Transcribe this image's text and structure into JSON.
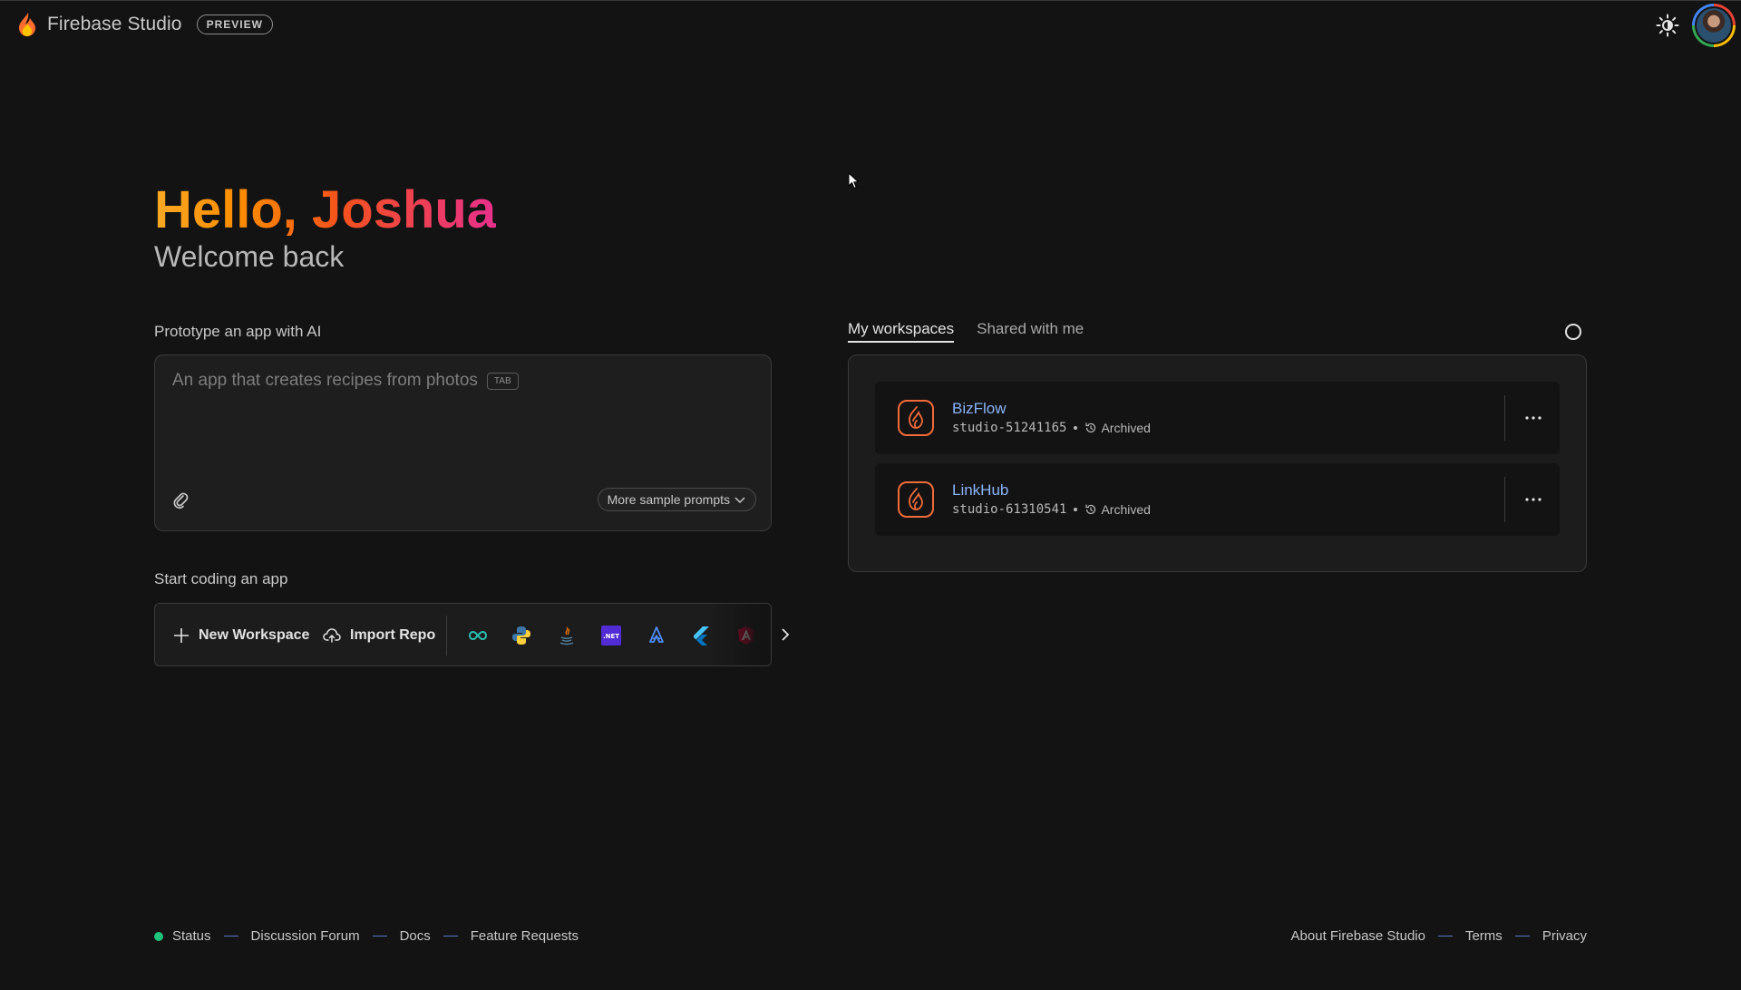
{
  "app": {
    "name": "Firebase Studio",
    "badge": "PREVIEW"
  },
  "greeting": {
    "hello": "Hello, Joshua",
    "subtitle": "Welcome back"
  },
  "prototype": {
    "label": "Prototype an app with AI",
    "placeholder": "An app that creates recipes from photos",
    "tab_hint": "TAB",
    "samples_button": "More sample prompts"
  },
  "coding": {
    "label": "Start coding an app",
    "new_workspace": "New Workspace",
    "import_repo": "Import Repo",
    "templates": [
      "go-icon",
      "python-icon",
      "java-icon",
      "dotnet-icon",
      "astro-icon",
      "flutter-icon",
      "angular-icon"
    ],
    "dotnet_label": ".NET"
  },
  "workspaces": {
    "tabs": [
      {
        "label": "My workspaces",
        "active": true
      },
      {
        "label": "Shared with me",
        "active": false
      }
    ],
    "items": [
      {
        "name": "BizFlow",
        "id": "studio-51241165",
        "status": "Archived"
      },
      {
        "name": "LinkHub",
        "id": "studio-61310541",
        "status": "Archived"
      }
    ]
  },
  "footer": {
    "left": [
      "Status",
      "Discussion Forum",
      "Docs",
      "Feature Requests"
    ],
    "right": [
      "About Firebase Studio",
      "Terms",
      "Privacy"
    ]
  },
  "colors": {
    "background": "#131313",
    "accent_link": "#8ab4f8",
    "status_ok": "#1ec27b",
    "brand_orange": "#f26b3a"
  }
}
